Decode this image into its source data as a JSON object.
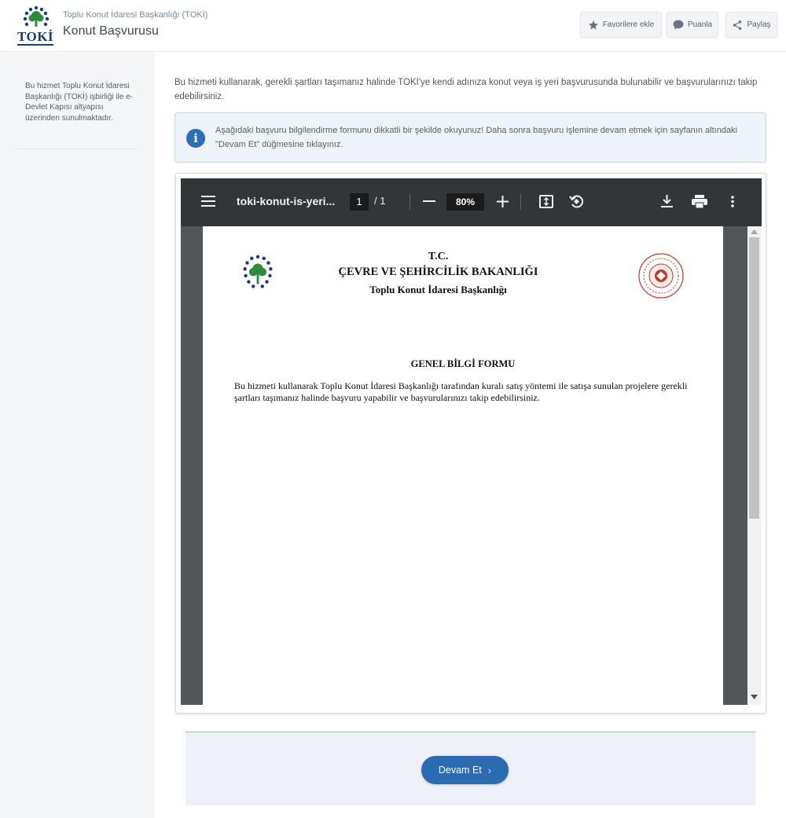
{
  "header": {
    "logo_text": "TOKİ",
    "org_name": "Toplu Konut İdaresi Başkanlığı (TOKİ)",
    "service_title": "Konut Başvurusu",
    "buttons": {
      "favorite": "Favorilere ekle",
      "rate": "Puanla",
      "share": "Paylaş"
    }
  },
  "sidebar": {
    "description": "Bu hizmet Toplu Konut İdaresi Başkanlığı (TOKİ) işbirliği ile e-Devlet Kapısı altyapısı üzerinden sunulmaktadır."
  },
  "main": {
    "intro": "Bu hizmeti kullanarak, gerekli şartları taşımanız halinde TOKİ'ye kendi adınıza konut veya iş yeri başvurusunda bulunabilir ve başvurularınızı takip edebilirsiniz.",
    "info_icon": "i",
    "info_text": "Aşağıdaki başvuru bilgilendirme formunu dikkatli bir şekilde okuyunuz! Daha sonra başvuru işlemine devam etmek için sayfanın altındaki \"Devam Et\" düğmesine tıklayınız."
  },
  "pdf_viewer": {
    "doc_title": "toki-konut-is-yeri...",
    "current_page": "1",
    "page_separator": "/ 1",
    "zoom": "80%",
    "scroll_position": 0,
    "document": {
      "line1": "T.C.",
      "line2": "ÇEVRE VE ŞEHİRCİLİK BAKANLIĞI",
      "line3": "Toplu Konut İdaresi Başkanlığı",
      "form_title": "GENEL BİLGİ FORMU",
      "paragraph": "Bu hizmeti kullanarak Toplu Konut İdaresi Başkanlığı tarafından kuralı satış yöntemi ile satışa sunulan projelere gerekli şartları taşımanız halinde başvuru yapabilir ve başvurularınızı takip edebilirsiniz."
    }
  },
  "footer": {
    "continue_label": "Devam Et",
    "continue_chevron": "›"
  },
  "colors": {
    "primary": "#2c6bb0",
    "toolbar": "#323639",
    "viewer_bg": "#525659",
    "info_bg": "#eef3f9",
    "logo_green": "#2e8b3e",
    "logo_blue": "#1a3a7a"
  },
  "icons": [
    "toki-logo",
    "star-icon",
    "comment-icon",
    "share-icon",
    "info-icon",
    "menu-icon",
    "minus-icon",
    "plus-icon",
    "fit-page-icon",
    "rotate-icon",
    "download-icon",
    "print-icon",
    "more-icon",
    "seal-icon"
  ]
}
